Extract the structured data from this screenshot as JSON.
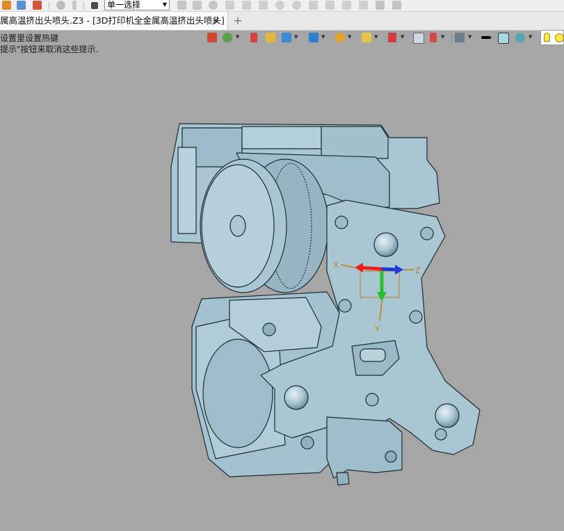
{
  "toolbar": {
    "selection_filter_value": "单一选择"
  },
  "tab": {
    "title": "属高温挤出头喷头.Z3 - [3D打印机全金属高温挤出头喷头]",
    "close_symbol": "✕",
    "add_symbol": "+"
  },
  "hint": {
    "line1": "设置里设置热键",
    "line2": "提示\"按钮来取消这些提示."
  },
  "triad": {
    "x_label": "X",
    "y_label": "Y",
    "z_label": "Z",
    "x_color": "#e8201c",
    "y_color": "#28c028",
    "z_color": "#1e3ad8",
    "handle_color": "#d07a10"
  },
  "model": {
    "name": "3D打印机全金属高温挤出头喷头",
    "surface_color": "#a9c7d3",
    "edge_color": "#1d2a31"
  },
  "viewport": {
    "background": "#a6a6a6"
  }
}
